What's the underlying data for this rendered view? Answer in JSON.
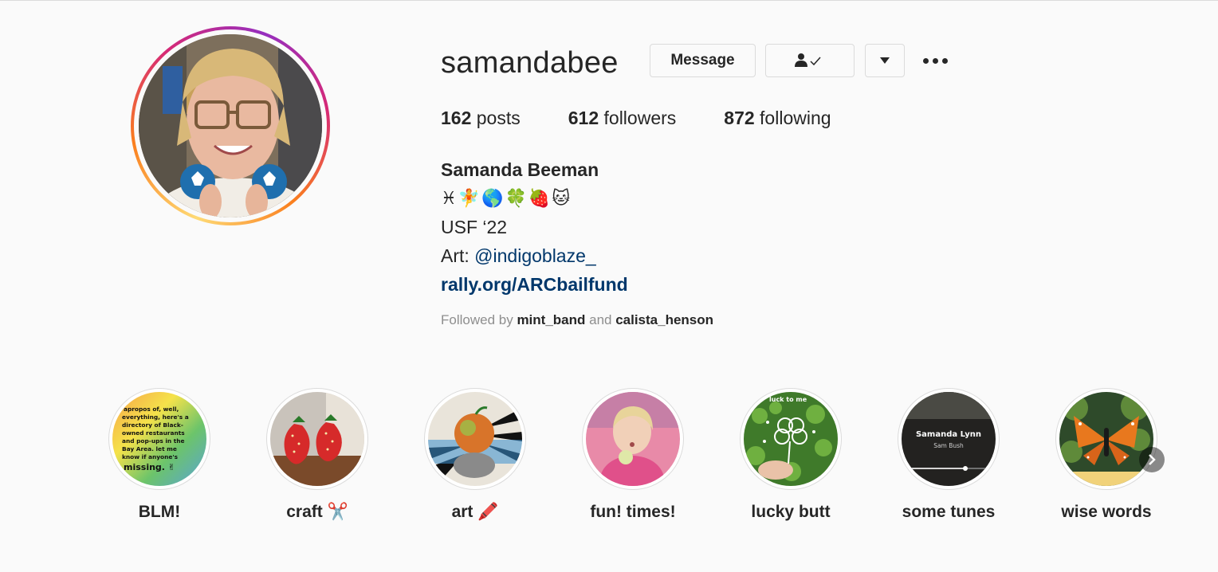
{
  "profile": {
    "username": "samandabee",
    "message_label": "Message",
    "posts_count": "162",
    "posts_label": "posts",
    "followers_count": "612",
    "followers_label": "followers",
    "following_count": "872",
    "following_label": "following"
  },
  "bio": {
    "name": "Samanda Beeman",
    "emoji_line": "♓🧚🌎🍀🍓🐱",
    "line1": "USF ‘22",
    "art_prefix": "Art: ",
    "art_mention": "@indigoblaze_",
    "link": "rally.org/ARCbailfund"
  },
  "followed_by": {
    "prefix": "Followed by ",
    "user1": "mint_band",
    "conjunction": " and ",
    "user2": "calista_henson"
  },
  "highlights": [
    {
      "label": "BLM!",
      "text": [
        "apropos of, well,",
        "everything, here's a",
        "directory of Black-",
        "owned restaurants",
        "and pop-ups in the",
        "Bay Area. let me",
        "know if anyone's",
        "missing. ✌"
      ]
    },
    {
      "label": "craft ✂️"
    },
    {
      "label": "art 🖍️"
    },
    {
      "label": "fun! times!"
    },
    {
      "label": "lucky butt",
      "text": [
        "luck to me"
      ]
    },
    {
      "label": "some tunes",
      "text": [
        "Samanda Lynn",
        "Sam Bush"
      ]
    },
    {
      "label": "wise words"
    }
  ],
  "colors": {
    "link": "#00376b",
    "text": "#262626",
    "muted": "#8e8e8e",
    "border": "#dbdbdb",
    "background": "#fafafa"
  }
}
